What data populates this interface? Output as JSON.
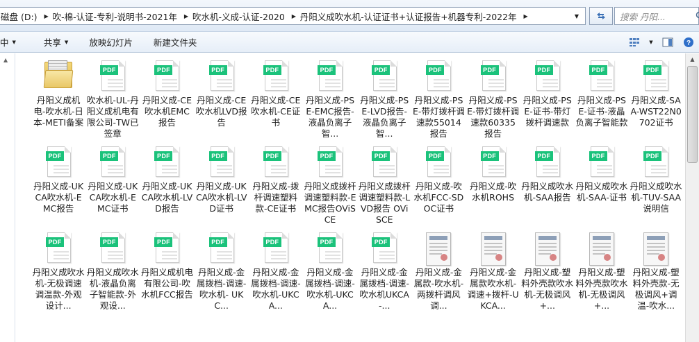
{
  "address": {
    "crumbs": [
      "磁盘 (D:)",
      "吹-棉-认证-专利-说明书-2021年",
      "吹水机-义成-认证-2020",
      "丹阳义成吹水机-认证证书+认证报告+机器专利-2022年"
    ]
  },
  "search": {
    "placeholder": "搜索 丹阳..."
  },
  "toolbar": {
    "organize_label": "中",
    "share_label": "共享",
    "slideshow_label": "放映幻灯片",
    "new_folder_label": "新建文件夹"
  },
  "files": [
    {
      "name": "丹阳义成机电-吹水机-日本-METI备案",
      "icon": "folder-icon"
    },
    {
      "name": "吹水机-UL-丹阳义成机电有限公司-TW已签章",
      "icon": "pdf-icon"
    },
    {
      "name": "丹阳义成-CE吹水机EMC报告",
      "icon": "pdf-icon"
    },
    {
      "name": "丹阳义成-CE吹水机LVD报告",
      "icon": "pdf-icon"
    },
    {
      "name": "丹阳义成-CE吹水机-CE证书",
      "icon": "pdf-icon"
    },
    {
      "name": "丹阳义成-PSE-EMC报告-液晶负离子智...",
      "icon": "pdf-icon"
    },
    {
      "name": "丹阳义成-PSE-LVD报告-液晶负离子智...",
      "icon": "pdf-icon"
    },
    {
      "name": "丹阳义成-PSE-带灯拨杆调速款55014报告",
      "icon": "pdf-icon"
    },
    {
      "name": "丹阳义成-PSE-带灯拨杆调速款60335报告",
      "icon": "pdf-icon"
    },
    {
      "name": "丹阳义成-PSE-证书-带灯拨杆调速款",
      "icon": "pdf-icon"
    },
    {
      "name": "丹阳义成-PSE-证书-液晶负离子智能款",
      "icon": "pdf-icon"
    },
    {
      "name": "丹阳义成-SAA-WST22N0702证书",
      "icon": "pdf-icon"
    },
    {
      "name": "丹阳义成-UKCA吹水机-EMC报告",
      "icon": "pdf-icon"
    },
    {
      "name": "丹阳义成-UKCA吹水机-EMC证书",
      "icon": "pdf-icon"
    },
    {
      "name": "丹阳义成-UKCA吹水机-LVD报告",
      "icon": "pdf-icon"
    },
    {
      "name": "丹阳义成-UKCA吹水机-LVD证书",
      "icon": "pdf-icon"
    },
    {
      "name": "丹阳义成-拨杆调速塑料款-CE证书",
      "icon": "pdf-icon"
    },
    {
      "name": "丹阳义成拨杆调速塑料款-EMC报告OViSCE",
      "icon": "pdf-icon"
    },
    {
      "name": "丹阳义成拨杆调速塑料款-LVD报告 OViSCE",
      "icon": "pdf-icon"
    },
    {
      "name": "丹阳义成-吹水机FCC-SDOC证书",
      "icon": "pdf-icon"
    },
    {
      "name": "丹阳义成-吹水机ROHS",
      "icon": "pdf-icon"
    },
    {
      "name": "丹阳义成吹水机-SAA报告",
      "icon": "pdf-icon"
    },
    {
      "name": "丹阳义成吹水机-SAA-证书",
      "icon": "pdf-icon"
    },
    {
      "name": "丹阳义成吹水机-TUV-SAA说明信",
      "icon": "pdf-icon"
    },
    {
      "name": "丹阳义成吹水机-无极调速调温款-外观设计...",
      "icon": "pdf-icon"
    },
    {
      "name": "丹阳义成吹水机-液晶负离子智能款-外观设...",
      "icon": "pdf-icon"
    },
    {
      "name": "丹阳义成机电有限公司-吹水机FCC报告",
      "icon": "pdf-icon"
    },
    {
      "name": "丹阳义成-金属拨档-调速-吹水机- UKC...",
      "icon": "pdf-icon"
    },
    {
      "name": "丹阳义成-金属拨档-调速-吹水机-UKCA...",
      "icon": "pdf-icon"
    },
    {
      "name": "丹阳义成-金属拨档-调速-吹水机-UKCA...",
      "icon": "pdf-icon"
    },
    {
      "name": "丹阳义成-金属拨档-调速-吹水机UKCA-...",
      "icon": "pdf-icon"
    },
    {
      "name": "丹阳义成-金属款-吹水机-两拨杆调风调...",
      "icon": "image-icon"
    },
    {
      "name": "丹阳义成-金属款吹水机-调速+拨杆-UKCA...",
      "icon": "image-icon"
    },
    {
      "name": "丹阳义成-塑料外壳款吹水机-无极调风+...",
      "icon": "image-icon"
    },
    {
      "name": "丹阳义成-塑料外壳款吹水机-无极调风+...",
      "icon": "image-icon"
    },
    {
      "name": "丹阳义成-塑料外壳款-无极调风+调温-吹水...",
      "icon": "image-icon"
    }
  ]
}
